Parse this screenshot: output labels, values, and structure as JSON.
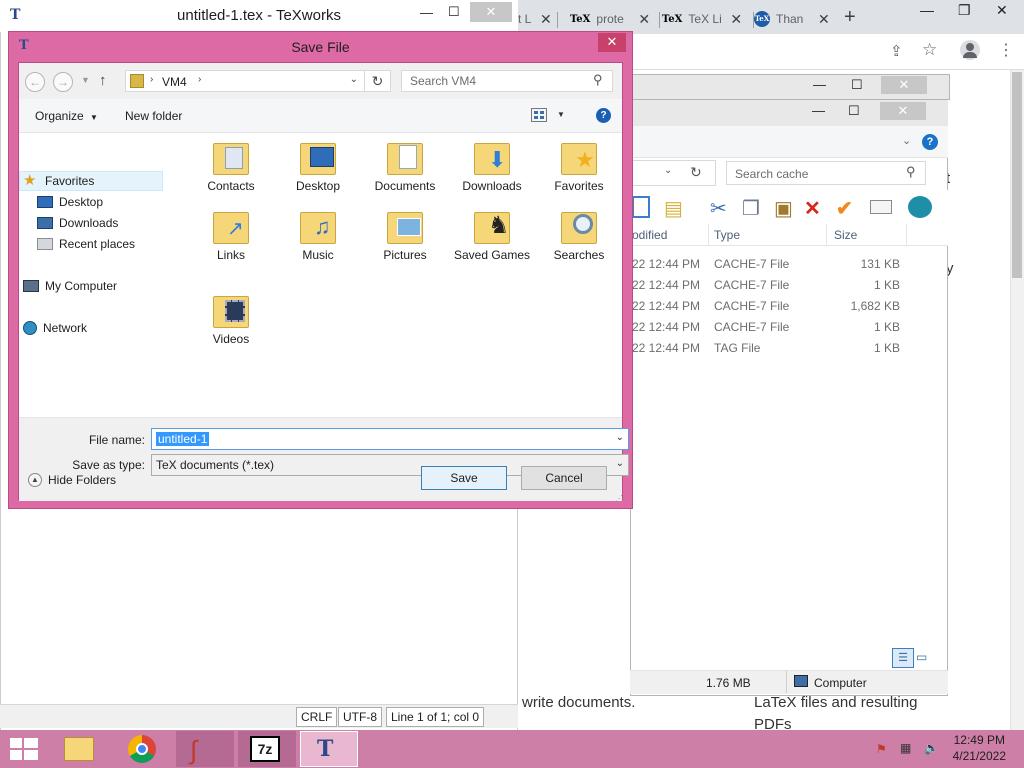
{
  "texworks": {
    "title": "untitled-1.tex - TeXworks",
    "status": {
      "line_ending": "CRLF",
      "encoding": "UTF-8",
      "position": "Line 1 of 1; col 0"
    }
  },
  "browser": {
    "tabs": [
      {
        "icon": "TeX",
        "title": "prote"
      },
      {
        "icon": "TeX",
        "title": "TeX Li"
      },
      {
        "icon": "TeX",
        "title": "Than"
      }
    ],
    "tab_partial": "t L",
    "content_text_1": "write documents.",
    "content_text_2": "LaTeX files and resulting",
    "content_text_3": "PDFs",
    "side_letters": [
      "t",
      "y"
    ]
  },
  "explorer": {
    "search_placeholder": "Search cache",
    "columns": {
      "modified": "odified",
      "type": "Type",
      "size": "Size"
    },
    "files": [
      {
        "modified": "22 12:44 PM",
        "type": "CACHE-7 File",
        "size": "131 KB"
      },
      {
        "modified": "22 12:44 PM",
        "type": "CACHE-7 File",
        "size": "1 KB"
      },
      {
        "modified": "22 12:44 PM",
        "type": "CACHE-7 File",
        "size": "1,682 KB"
      },
      {
        "modified": "22 12:44 PM",
        "type": "CACHE-7 File",
        "size": "1 KB"
      },
      {
        "modified": "22 12:44 PM",
        "type": "TAG File",
        "size": "1 KB"
      }
    ],
    "status_size": "1.76 MB",
    "status_location": "Computer"
  },
  "dialog": {
    "title": "Save File",
    "close_symbol": "✕",
    "path": "VM4",
    "search_placeholder": "Search VM4",
    "organize_label": "Organize",
    "new_folder_label": "New folder",
    "nav": {
      "favorites": "Favorites",
      "favorites_items": [
        "Desktop",
        "Downloads",
        "Recent places"
      ],
      "my_computer": "My Computer",
      "network": "Network"
    },
    "folders": [
      {
        "label": "Contacts",
        "icon": "contacts-icon"
      },
      {
        "label": "Desktop",
        "icon": "desktop-icon"
      },
      {
        "label": "Documents",
        "icon": "documents-icon"
      },
      {
        "label": "Downloads",
        "icon": "downloads-icon"
      },
      {
        "label": "Favorites",
        "icon": "favorites-icon"
      },
      {
        "label": "Links",
        "icon": "links-icon"
      },
      {
        "label": "Music",
        "icon": "music-icon"
      },
      {
        "label": "Pictures",
        "icon": "pictures-icon"
      },
      {
        "label": "Saved Games",
        "icon": "saved-games-icon"
      },
      {
        "label": "Searches",
        "icon": "searches-icon"
      },
      {
        "label": "Videos",
        "icon": "videos-icon"
      }
    ],
    "file_name_label": "File name:",
    "file_name_value": "untitled-1",
    "save_as_type_label": "Save as type:",
    "save_as_type_value": "TeX documents (*.tex)",
    "hide_folders_label": "Hide Folders",
    "save_label": "Save",
    "cancel_label": "Cancel"
  },
  "taskbar": {
    "time": "12:49 PM",
    "date": "4/21/2022",
    "apps": [
      "file-explorer-icon",
      "chrome-icon",
      "texworks-curve-icon",
      "7zip-icon",
      "texworks-icon"
    ]
  },
  "colors": {
    "dialog_frame": "#dd6aa5",
    "taskbar": "#ce7fa7",
    "selection": "#3399ff"
  }
}
